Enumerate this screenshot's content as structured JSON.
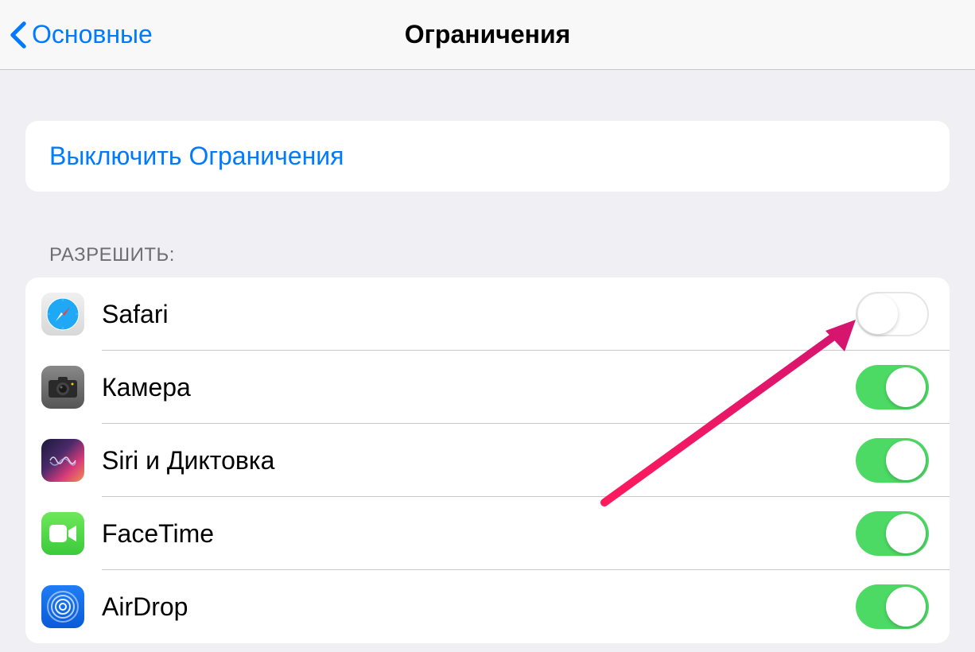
{
  "nav": {
    "back_label": "Основные",
    "title": "Ограничения"
  },
  "disable_button": {
    "label": "Выключить Ограничения"
  },
  "section": {
    "header": "РАЗРЕШИТЬ:"
  },
  "apps": [
    {
      "id": "safari",
      "label": "Safari",
      "enabled": false
    },
    {
      "id": "camera",
      "label": "Камера",
      "enabled": true
    },
    {
      "id": "siri",
      "label": "Siri и Диктовка",
      "enabled": true
    },
    {
      "id": "facetime",
      "label": "FaceTime",
      "enabled": true
    },
    {
      "id": "airdrop",
      "label": "AirDrop",
      "enabled": true
    }
  ],
  "colors": {
    "ios_blue": "#007aff",
    "ios_green": "#4cd964",
    "bg": "#efeff4",
    "annotation": "#e91e63"
  }
}
